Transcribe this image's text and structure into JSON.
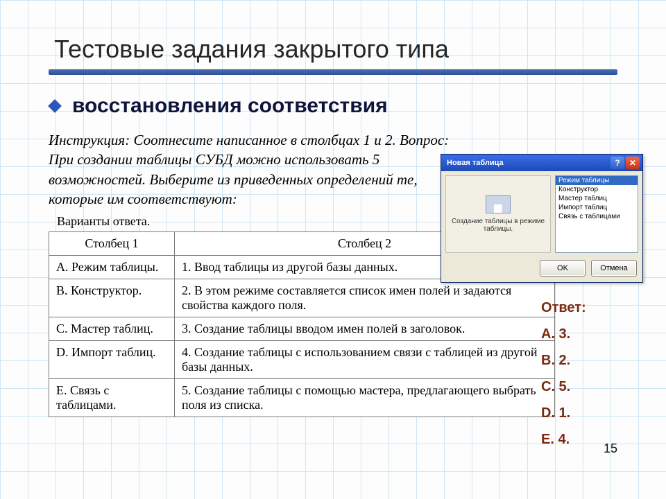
{
  "title": "Тестовые задания закрытого типа",
  "subtitle": "восстановления соответствия",
  "instruction": "Инструкция: Соотнесите написанное в столбцах 1 и 2. Вопрос: При создании таблицы СУБД можно использовать 5 возможностей. Выберите из приведенных определений те, которые им соответствуют:",
  "variants_label": "Варианты ответа.",
  "table": {
    "header1": "Столбец 1",
    "header2": "Столбец 2",
    "rows": [
      {
        "c1": "A. Режим таблицы.",
        "c2": "1. Ввод таблицы из другой базы данных."
      },
      {
        "c1": "B. Конструктор.",
        "c2": "2. В этом режиме составляется список имен полей и задаются свойства каждого поля."
      },
      {
        "c1": "C. Мастер таблиц.",
        "c2": "3. Создание таблицы вводом имен полей в заголовок."
      },
      {
        "c1": "D. Импорт таблиц.",
        "c2": "4. Создание таблицы с использованием связи с таблицей из другой базы данных."
      },
      {
        "c1": "E. Связь с таблицами.",
        "c2": "5. Создание таблицы с помощью мастера, предлагающего выбрать поля из списка."
      }
    ]
  },
  "answer": {
    "label": "Ответ:",
    "items": [
      "A. 3.",
      "B. 2.",
      "C. 5.",
      "D. 1.",
      "E. 4."
    ]
  },
  "page_number": "15",
  "dialog": {
    "title": "Новая таблица",
    "left_caption": "Создание таблицы в режиме таблицы.",
    "options": [
      "Режим таблицы",
      "Конструктор",
      "Мастер таблиц",
      "Импорт таблиц",
      "Связь с таблицами"
    ],
    "ok": "OK",
    "cancel": "Отмена",
    "help_glyph": "?",
    "close_glyph": "✕"
  }
}
